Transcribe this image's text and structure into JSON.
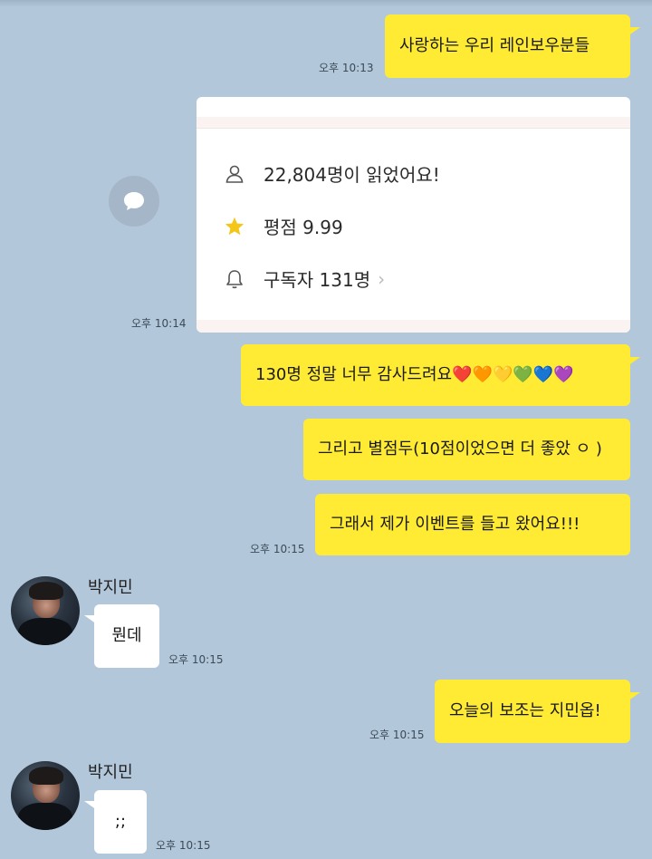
{
  "messages": {
    "m1": {
      "text": "사랑하는 우리 레인보우분들",
      "time": "오후 10:13"
    },
    "card": {
      "readers": "22,804명이 읽었어요!",
      "rating": "평점 9.99",
      "subscribers": "구독자 131명",
      "chevron": "›",
      "time": "오후 10:14"
    },
    "m2": {
      "text": "130명 정말 너무 감사드려요❤️🧡💛💚💙💜"
    },
    "m3": {
      "text": "그리고 별점두(10점이었으면 더 좋았 ㅇ )"
    },
    "m4": {
      "text": "그래서 제가 이벤트를 들고 왔어요!!!",
      "time": "오후 10:15"
    },
    "in1": {
      "name": "박지민",
      "text": "뭔데",
      "time": "오후 10:15"
    },
    "m5": {
      "text": "오늘의 보조는 지민옵!",
      "time": "오후 10:15"
    },
    "in2": {
      "name": "박지민",
      "text": ";;",
      "time": "오후 10:15"
    }
  },
  "colors": {
    "background": "#b2c7da",
    "outgoing": "#ffeb33",
    "incoming": "#ffffff",
    "star": "#f5c518"
  },
  "icons": {
    "readers": "person-icon",
    "rating": "star-icon",
    "subscribers": "bell-icon",
    "share": "speech-bubble-icon"
  }
}
